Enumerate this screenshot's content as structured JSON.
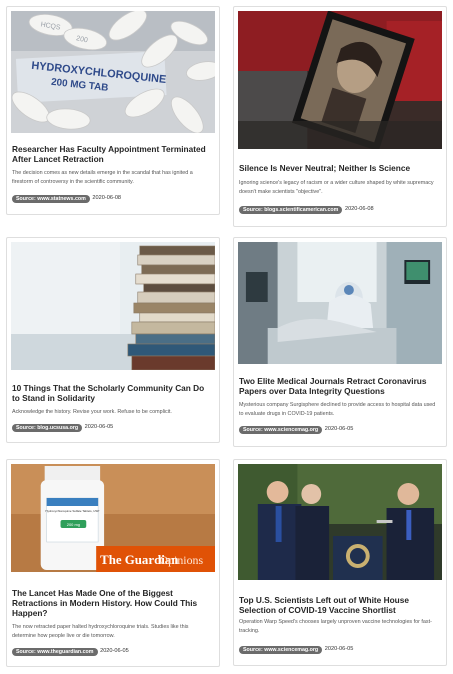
{
  "cards": [
    {
      "title": "Researcher Has Faculty Appointment Terminated After Lancet Retraction",
      "description": "The decision comes as new details emerge in the scandal that has ignited a firestorm of controversy in the scientific community.",
      "source": "Source: www.statnews.com",
      "date": "2020-06-08",
      "image_text": {
        "line1": "HYDROXYCHLOROQUINE",
        "line2": "200 MG TAB",
        "pill1": "HCQS",
        "pill2": "200"
      }
    },
    {
      "title": "Silence Is Never Neutral; Neither Is Science",
      "description": "Ignoring science's legacy of racism or a wider culture shaped by white supremacy doesn't make scientists \"objective\".",
      "source": "Source: blogs.scientificamerican.com",
      "date": "2020-06-08"
    },
    {
      "title": "10 Things That the Scholarly Community Can Do to Stand in Solidarity",
      "description": "Acknowledge the history. Revise your work. Refuse to be complicit.",
      "source": "Source: blog.ucsusa.org",
      "date": "2020-06-05"
    },
    {
      "title": "Two Elite Medical Journals Retract Coronavirus Papers over Data Integrity Questions",
      "description": "Mysterious company Surgisphere declined to provide access to hospital data used to evaluate drugs in COVID-19 patients.",
      "source": "Source: www.sciencemag.org",
      "date": "2020-06-05"
    },
    {
      "title": "The Lancet Has Made One of the Biggest Retractions in Modern History. How Could This Happen?",
      "description": "The now retracted paper halted hydroxychloroquine trials. Studies like this determine how people live or die tomorrow.",
      "source": "Source: www.theguardian.com",
      "date": "2020-06-05",
      "image_text": {
        "brand": "The Guardian",
        "section": "Opinions",
        "bottle": "Hydroxychloroquine Sulfate Tablets, USP",
        "dose": "200 mg"
      }
    },
    {
      "title": "Top U.S. Scientists Left out of White House Selection of COVID-19 Vaccine Shortlist",
      "description": "Operation Warp Speed's chooses largely unproven vaccine technologies for fast-tracking.",
      "source": "Source: www.sciencemag.org",
      "date": "2020-06-05"
    }
  ]
}
